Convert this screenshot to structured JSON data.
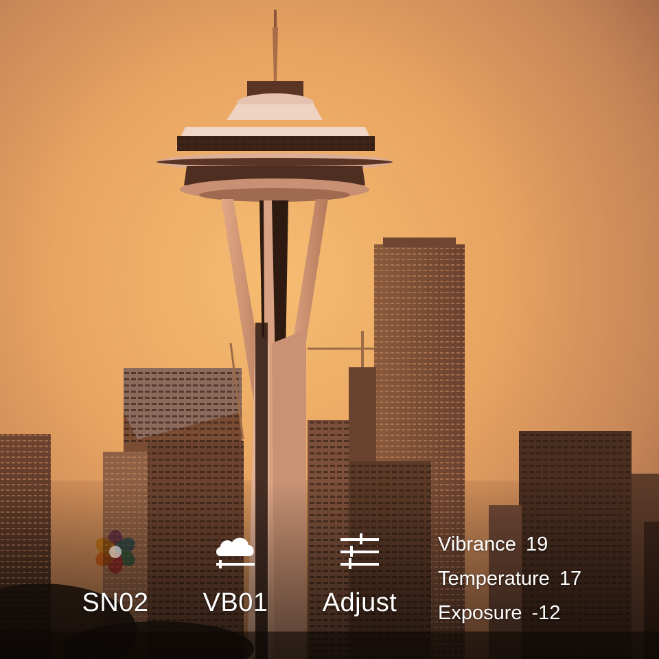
{
  "photo": {
    "subject": "space-needle-skyline-sunset",
    "sky_color_top": "#c98a5a",
    "sky_color_glow": "#f4b36a",
    "skyline_color": "#5a3824"
  },
  "toolbar": {
    "tools": [
      {
        "label": "SN02",
        "icon": "petal-flower-icon"
      },
      {
        "label": "VB01",
        "icon": "cloud-slider-icon"
      },
      {
        "label": "Adjust",
        "icon": "sliders-icon"
      }
    ],
    "settings": [
      {
        "name": "Vibrance",
        "value": "19"
      },
      {
        "name": "Temperature",
        "value": "17"
      },
      {
        "name": "Exposure",
        "value": "-12"
      }
    ]
  },
  "colors": {
    "text": "#ffffff",
    "petal_orange": "#f7a23a",
    "petal_yellow": "#f7d546",
    "petal_pink": "#ef6b8a",
    "petal_purple": "#b07ce8",
    "petal_blue": "#5ab6f0",
    "petal_teal": "#58d1c0"
  }
}
